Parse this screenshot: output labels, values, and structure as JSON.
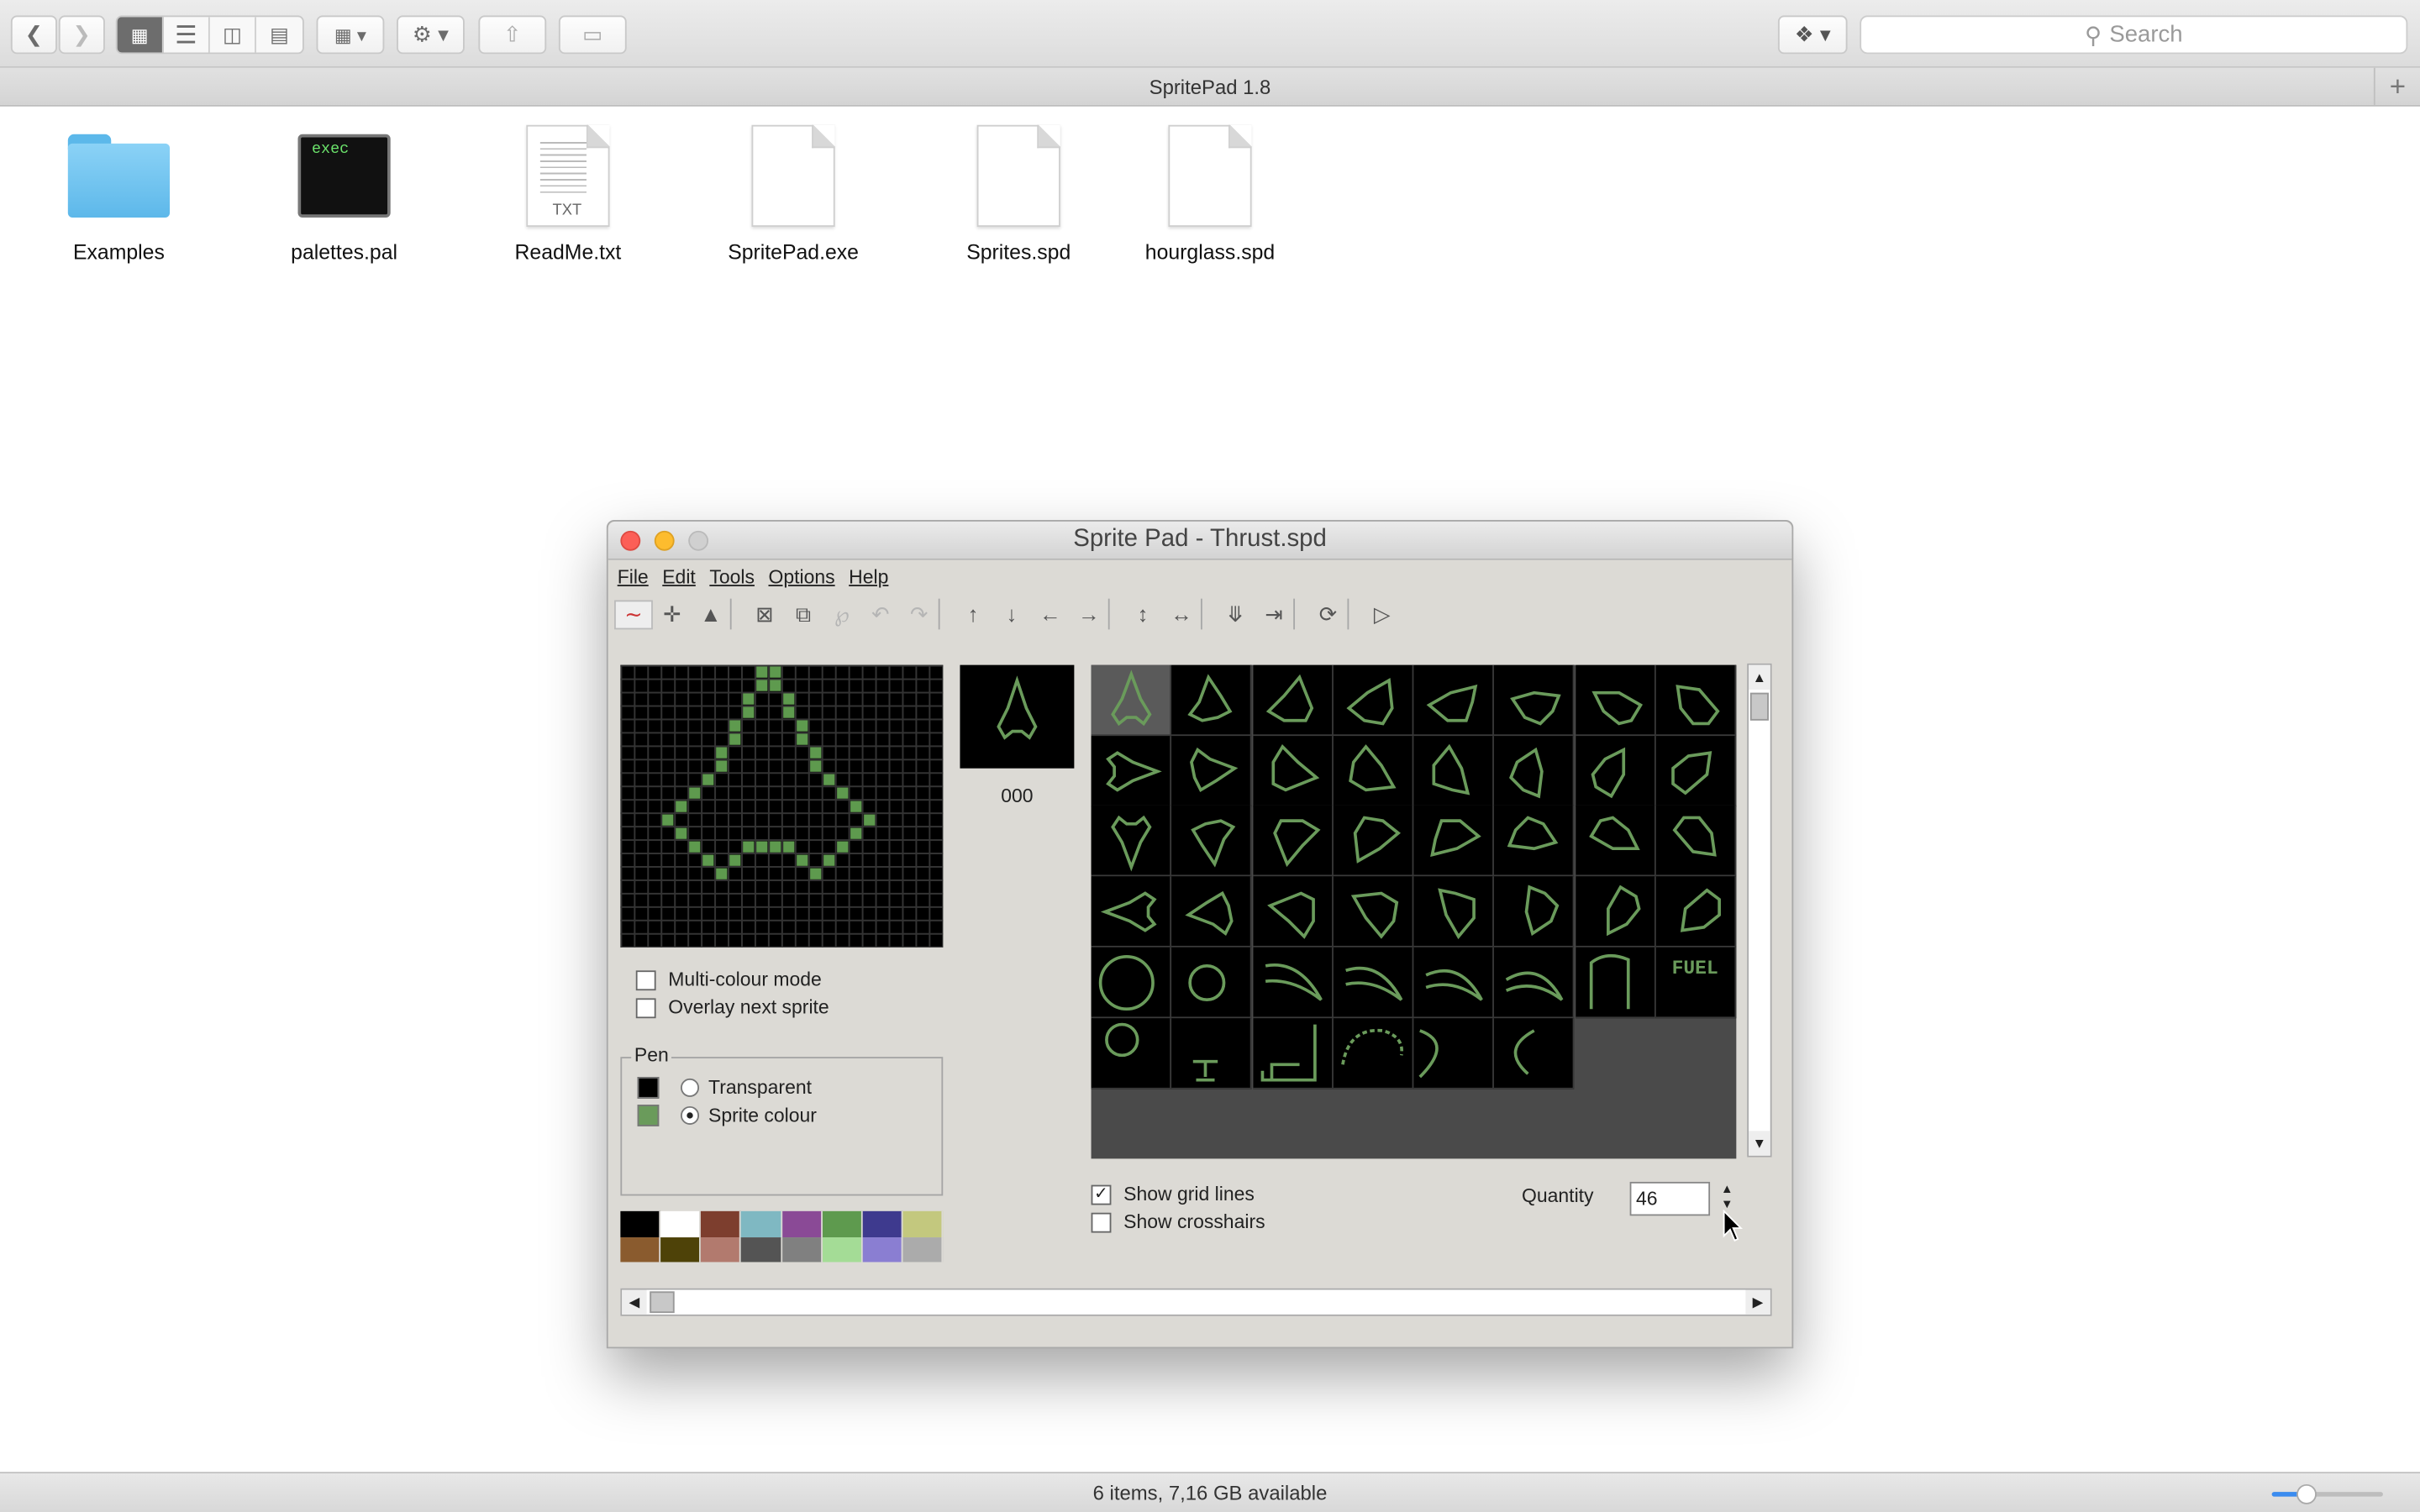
{
  "finder": {
    "toolbar": {
      "back_icon": "chevron-left-icon",
      "forward_icon": "chevron-right-icon",
      "view_modes": [
        "icon-view",
        "list-view",
        "column-view",
        "cover-flow-view"
      ],
      "selected_view": "icon-view",
      "search_placeholder": "Search"
    },
    "window_title": "SpritePad 1.8",
    "files": [
      {
        "name": "Examples",
        "kind": "folder"
      },
      {
        "name": "palettes.pal",
        "kind": "exec",
        "badge": "exec"
      },
      {
        "name": "ReadMe.txt",
        "kind": "text",
        "badge": "TXT"
      },
      {
        "name": "SpritePad.exe",
        "kind": "document"
      },
      {
        "name": "Sprites.spd",
        "kind": "document"
      },
      {
        "name": "hourglass.spd",
        "kind": "document"
      }
    ],
    "status": "6 items, 7,16 GB available",
    "icon_size_fraction": 0.3
  },
  "spritepad": {
    "title": "Sprite Pad - Thrust.spd",
    "menu": [
      "File",
      "Edit",
      "Tools",
      "Options",
      "Help"
    ],
    "current_sprite_number": "000",
    "multicolour_label": "Multi-colour mode",
    "multicolour_checked": false,
    "overlay_label": "Overlay next sprite",
    "overlay_checked": false,
    "pen": {
      "label": "Pen",
      "transparent_label": "Transparent",
      "sprite_colour_label": "Sprite colour",
      "selected": "sprite_colour",
      "transparent_color": "#000000",
      "sprite_color": "#6a9b5b"
    },
    "palette": [
      "#000000",
      "#ffffff",
      "#7d3e2e",
      "#7fb8c2",
      "#8a4a96",
      "#5e9a4e",
      "#3e3a8e",
      "#c3c87e",
      "#8a5b2e",
      "#4e4208",
      "#b27a6e",
      "#545454",
      "#808080",
      "#a4dc96",
      "#8a7ed2",
      "#ababab"
    ],
    "show_grid_label": "Show grid lines",
    "show_grid_checked": true,
    "show_crosshairs_label": "Show crosshairs",
    "show_crosshairs_checked": false,
    "quantity_label": "Quantity",
    "quantity_value": "46",
    "fuel_label": "FUEL",
    "sprite_count": 46
  }
}
